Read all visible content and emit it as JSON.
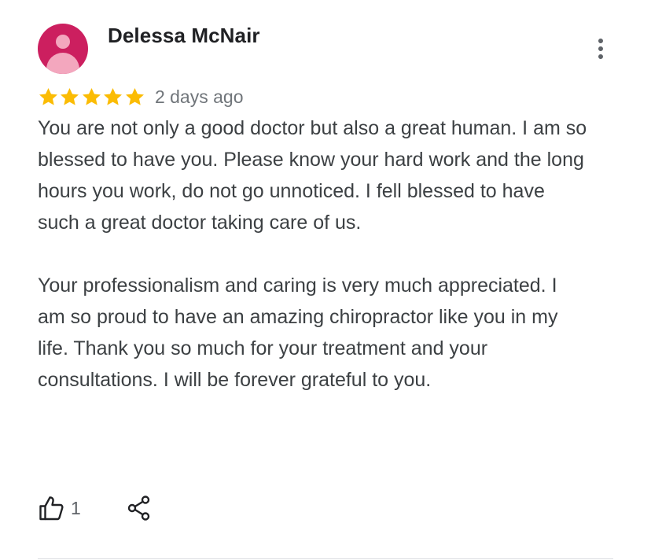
{
  "review": {
    "author": "Delessa McNair",
    "rating": 5,
    "max_rating": 5,
    "time": "2 days ago",
    "paragraphs": [
      "You are not only a good doctor but also a great human.  I am so blessed to have you.  Please know your hard work and the long hours you work, do not go unnoticed.  I fell blessed to have such a great doctor taking care of us.",
      "Your professionalism and caring is very much appreciated.  I am so proud to have an amazing chiropractor like you in my life.  Thank you so much for your treatment and your consultations. I will be forever grateful to you."
    ],
    "likes": "1"
  },
  "icons": {
    "avatar": "person-avatar-icon",
    "more": "more-vert-icon",
    "star": "star-icon",
    "like": "thumb-up-icon",
    "share": "share-icon"
  },
  "colors": {
    "avatar_background": "#cc1f5f",
    "avatar_figure": "#f3a7be",
    "star": "#fbbc04",
    "name": "#202124",
    "body_text": "#3c4043",
    "secondary_text": "#70757a",
    "divider": "#dadce0"
  }
}
